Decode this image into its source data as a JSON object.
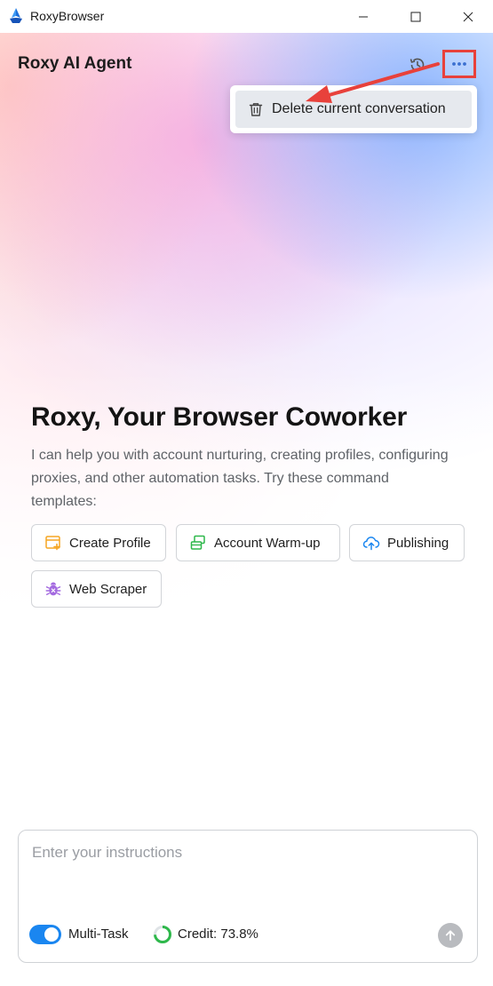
{
  "window": {
    "app_name": "RoxyBrowser",
    "controls": [
      "minimize-icon",
      "maximize-icon",
      "close-icon"
    ]
  },
  "header": {
    "title": "Roxy AI Agent",
    "history_icon": "history-icon",
    "more_icon": "more-horizontal-icon"
  },
  "menu": {
    "items": [
      {
        "label": "Delete current conversation",
        "icon": "trash-icon"
      }
    ]
  },
  "hero": {
    "title": "Roxy, Your Browser Coworker",
    "description": "I can help you with account nurturing, creating profiles, configuring proxies, and other automation tasks. Try these command templates:"
  },
  "templates": [
    {
      "label": "Create Profile",
      "icon": "create-profile-icon",
      "color": "#f5a623"
    },
    {
      "label": "Account Warm-up",
      "icon": "account-warmup-icon",
      "color": "#2eb84b"
    },
    {
      "label": "Publishing",
      "icon": "cloud-upload-icon",
      "color": "#1a86f0"
    },
    {
      "label": "Web Scraper",
      "icon": "bug-icon",
      "color": "#a46be0"
    }
  ],
  "composer": {
    "placeholder": "Enter your instructions",
    "multitask_label": "Multi-Task",
    "multitask_enabled": true,
    "credit_label": "Credit: 73.8%",
    "credit_fraction": 0.738,
    "send_icon": "arrow-up-icon"
  },
  "colors": {
    "accent": "#1a86f0",
    "annotation": "#e8413b",
    "menu_highlight": "#e6e9ee"
  }
}
